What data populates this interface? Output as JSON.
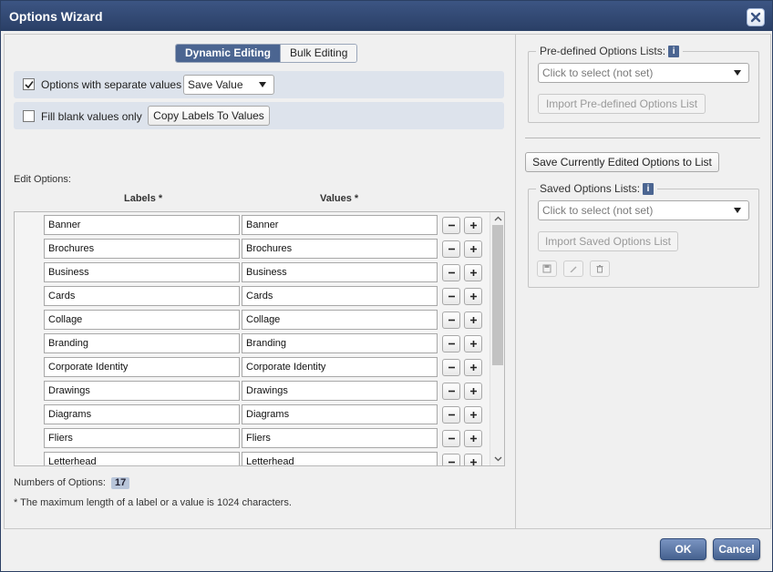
{
  "window": {
    "title": "Options Wizard"
  },
  "tabs": [
    {
      "label": "Dynamic Editing",
      "active": true
    },
    {
      "label": "Bulk Editing",
      "active": false
    }
  ],
  "options": {
    "separate_values_label": "Options with separate values",
    "separate_values_checked": true,
    "save_select_value": "Save Value",
    "fill_blank_label": "Fill blank values only",
    "fill_blank_checked": false,
    "copy_labels_button": "Copy Labels To Values"
  },
  "edit": {
    "section_label": "Edit Options:",
    "labels_header": "Labels *",
    "values_header": "Values *",
    "rows": [
      {
        "label": "Banner",
        "value": "Banner"
      },
      {
        "label": "Brochures",
        "value": "Brochures"
      },
      {
        "label": "Business",
        "value": "Business"
      },
      {
        "label": "Cards",
        "value": "Cards"
      },
      {
        "label": "Collage",
        "value": "Collage"
      },
      {
        "label": "Branding",
        "value": "Branding"
      },
      {
        "label": "Corporate Identity",
        "value": "Corporate Identity"
      },
      {
        "label": "Drawings",
        "value": "Drawings"
      },
      {
        "label": "Diagrams",
        "value": "Diagrams"
      },
      {
        "label": "Fliers",
        "value": "Fliers"
      },
      {
        "label": "Letterhead",
        "value": "Letterhead"
      }
    ]
  },
  "summary": {
    "count_label": "Numbers of Options:",
    "count": "17",
    "note": "* The maximum length of a label or a value is 1024 characters."
  },
  "predefined": {
    "legend": "Pre-defined Options Lists:",
    "select_placeholder": "Click to select (not set)",
    "import_button": "Import Pre-defined Options List"
  },
  "saved": {
    "save_button": "Save Currently Edited Options to List",
    "legend": "Saved Options Lists:",
    "select_placeholder": "Click to select (not set)",
    "import_button": "Import Saved Options List"
  },
  "footer": {
    "ok_label": "OK",
    "cancel_label": "Cancel"
  },
  "colors": {
    "titlebar": "#2a3f66",
    "accent": "#4b6591",
    "row_bg": "#dde3ec"
  },
  "icons": {
    "info": "i"
  }
}
